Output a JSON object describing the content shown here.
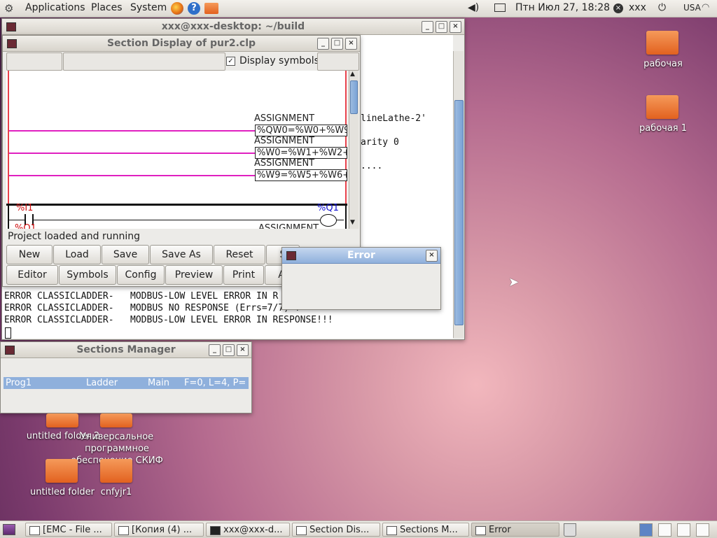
{
  "top_panel": {
    "menus": [
      "Applications",
      "Places",
      "System"
    ],
    "datetime": "Птн Июл 27, 18:28",
    "user": "xxx",
    "keyboard_layout": "USA"
  },
  "terminal": {
    "title": "xxx@xxx-desktop: ~/build",
    "fragments": [
      "lineLathe-2'",
      "arity 0",
      "...."
    ],
    "lines": [
      "ERROR CLASSICLADDER-   MODBUS-LOW LEVEL ERROR IN R",
      "ERROR CLASSICLADDER-   MODBUS NO RESPONSE (Errs=7/7) !",
      "ERROR CLASSICLADDER-   MODBUS-LOW LEVEL ERROR IN RESPONSE!!!"
    ]
  },
  "section_display": {
    "title": "Section Display of pur2.clp",
    "display_symbols_label": "Display symbols",
    "display_symbols_checked": true,
    "assignments": [
      {
        "label": "ASSIGNMENT",
        "expr": "%QW0=%W0+%W9"
      },
      {
        "label": "ASSIGNMENT",
        "expr": "%W0=%W1+%W2+"
      },
      {
        "label": "ASSIGNMENT",
        "expr": "%W9=%W5+%W6+"
      }
    ],
    "contact_label": "%I1",
    "coil_label": "%Q1",
    "partial_contact_label": "%Q1",
    "partial_assignment_label": "ASSIGNMENT",
    "status": "Project loaded and running",
    "buttons_row1": [
      "New",
      "Load",
      "Save",
      "Save As",
      "Reset",
      "S"
    ],
    "buttons_row2": [
      "Editor",
      "Symbols",
      "Config",
      "Preview",
      "Print",
      "A"
    ]
  },
  "error_dialog": {
    "title": "Error"
  },
  "sections_manager": {
    "title": "Sections Manager",
    "row": {
      "name": "Prog1",
      "language": "Ladder",
      "type": "Main",
      "info": "F=0, L=4, P="
    }
  },
  "desktop_icons": [
    {
      "label": "рабочая"
    },
    {
      "label": "рабочая 1"
    },
    {
      "label": "untitled folder 2"
    },
    {
      "label": "Универсальное программное обеспечение СКИФ"
    },
    {
      "label": "untitled folder"
    },
    {
      "label": "cnfyjr1"
    }
  ],
  "taskbar": [
    {
      "label": "[EMC - File ..."
    },
    {
      "label": "[Копия (4) ..."
    },
    {
      "label": "xxx@xxx-d..."
    },
    {
      "label": "Section Dis..."
    },
    {
      "label": "Sections M..."
    },
    {
      "label": "Error"
    }
  ]
}
